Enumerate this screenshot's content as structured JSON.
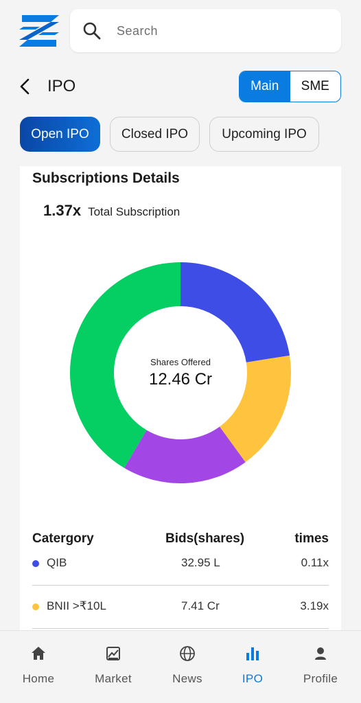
{
  "search": {
    "placeholder": "Search"
  },
  "header": {
    "title": "IPO",
    "segment": [
      "Main",
      "SME"
    ]
  },
  "filters": [
    "Open IPO",
    "Closed IPO",
    "Upcoming IPO"
  ],
  "subscription": {
    "title": "Subscriptions Details",
    "total_value": "1.37x",
    "total_label": "Total Subscription",
    "center_label": "Shares Offered",
    "center_value": "12.46 Cr"
  },
  "chart_data": {
    "type": "pie",
    "variant": "donut",
    "slices": [
      {
        "value": 22.5,
        "color": "#3d4de6"
      },
      {
        "value": 17.5,
        "color": "#ffc43d"
      },
      {
        "value": 18.5,
        "color": "#a247e5"
      },
      {
        "value": 41.5,
        "color": "#05cf63"
      }
    ],
    "start_angle_deg": 0
  },
  "table": {
    "headers": [
      "Catergory",
      "Bids(shares)",
      "times"
    ],
    "rows": [
      {
        "category": "QIB",
        "bids": "32.95 L",
        "times": "0.11x",
        "color": "#3d4de6"
      },
      {
        "category": "BNII >₹10L",
        "bids": "7.41 Cr",
        "times": "3.19x",
        "color": "#ffc43d"
      }
    ]
  },
  "nav": [
    {
      "label": "Home",
      "icon": "home-icon"
    },
    {
      "label": "Market",
      "icon": "market-icon"
    },
    {
      "label": "News",
      "icon": "globe-icon"
    },
    {
      "label": "IPO",
      "icon": "bar-chart-icon",
      "active": true
    },
    {
      "label": "Profile",
      "icon": "profile-icon"
    }
  ],
  "colors": {
    "accent": "#0a7be0"
  }
}
